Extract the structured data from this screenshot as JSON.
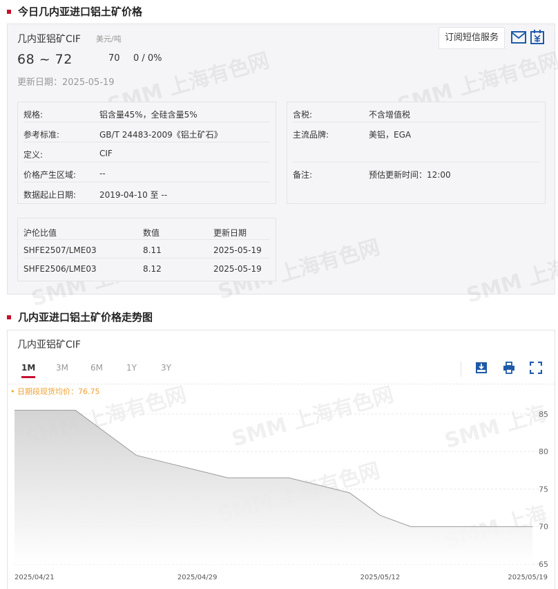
{
  "section1": {
    "title": "今日几内亚进口铝土矿价格"
  },
  "product": {
    "name": "几内亚铝矿CIF",
    "unit": "美元/吨",
    "price_range": "68 ~ 72",
    "mid_price": "70",
    "change": "0 / 0%",
    "update_date": "更新日期：2025-05-19"
  },
  "subscribe": {
    "label": "订阅短信服务",
    "mail_icon": "mail-icon",
    "calendar_icon": "calendar-icon"
  },
  "specs_left": [
    {
      "label": "规格:",
      "value": "铝含量45%，全硅含量5%"
    },
    {
      "label": "参考标准:",
      "value": "GB/T 24483-2009《铝土矿石》"
    },
    {
      "label": "定义:",
      "value": "CIF"
    },
    {
      "label": "价格产生区域:",
      "value": "--"
    },
    {
      "label": "数据起止日期:",
      "value": "2019-04-10 至 --"
    }
  ],
  "specs_right": [
    {
      "label": "含税:",
      "value": "不含增值税"
    },
    {
      "label": "主流品牌:",
      "value": "美铝，EGA"
    },
    {
      "label": "备注:",
      "value": "预估更新时间：12:00"
    }
  ],
  "ratio_table": {
    "headers": [
      "沪伦比值",
      "数值",
      "更新日期"
    ],
    "rows": [
      [
        "SHFE2507/LME03",
        "8.11",
        "2025-05-19"
      ],
      [
        "SHFE2506/LME03",
        "8.12",
        "2025-05-19"
      ]
    ]
  },
  "section2": {
    "title": "几内亚进口铝土矿价格走势图"
  },
  "chart_panel": {
    "title": "几内亚铝矿CIF",
    "tabs": [
      "1M",
      "3M",
      "6M",
      "1Y",
      "3Y"
    ],
    "active_tab": "1M",
    "tools": [
      "download-icon",
      "print-icon",
      "fullscreen-icon"
    ],
    "avg_label": "• 日期段现货均价：76.75"
  },
  "watermark": {
    "text": "SMM 上海有色网"
  },
  "chart_data": {
    "type": "area",
    "x": [
      "2025-04-21",
      "2025-04-22",
      "2025-04-23",
      "2025-04-24",
      "2025-04-25",
      "2025-04-28",
      "2025-04-29",
      "2025-04-30",
      "2025-05-06",
      "2025-05-07",
      "2025-05-08",
      "2025-05-09",
      "2025-05-12",
      "2025-05-13",
      "2025-05-14",
      "2025-05-15",
      "2025-05-16",
      "2025-05-19"
    ],
    "series": [
      {
        "values": [
          85.5,
          85.5,
          85.5,
          82.5,
          79.5,
          78.5,
          77.5,
          76.5,
          76.5,
          76.5,
          75.5,
          74.5,
          71.5,
          70,
          70,
          70,
          70,
          70
        ]
      }
    ],
    "x_tick_labels": [
      "2025/04/21",
      "2025/04/29",
      "2025/05/12",
      "2025/05/19"
    ],
    "y_ticks": [
      65,
      70,
      75,
      80,
      85
    ],
    "ylim": [
      65,
      86
    ],
    "grid": true,
    "colors": {
      "line": "#9a9a9a",
      "fill_top": "#cfcfcf",
      "fill_bottom": "#ffffff"
    }
  }
}
